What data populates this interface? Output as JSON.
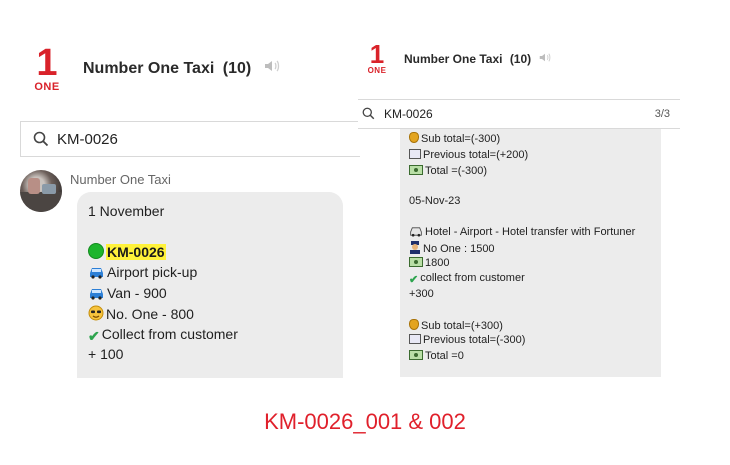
{
  "left_panel": {
    "logo": {
      "number": "1",
      "word": "ONE"
    },
    "chat_title": "Number One Taxi",
    "member_count": "(10)",
    "search_value": "KM-0026",
    "sender_name": "Number One Taxi",
    "message_lines": [
      "1 November",
      "KM-0026",
      "Airport pick-up",
      "Van - 900",
      "No. One - 800",
      "Collect from customer",
      "+ 100"
    ]
  },
  "right_panel": {
    "logo": {
      "number": "1",
      "word": "ONE"
    },
    "chat_title": "Number One Taxi",
    "member_count": "(10)",
    "search_value": "KM-0026",
    "match_counter": "3/3",
    "message_lines": [
      "Sub total=(-300)",
      "Previous total=(+200)",
      "Total =(-300)",
      "05-Nov-23",
      "Hotel - Airport - Hotel transfer with Fortuner",
      "No One : 1500",
      "1800",
      "collect from customer",
      "+300",
      "Sub total=(+300)",
      "Previous total=(-300)",
      "Total =0"
    ]
  },
  "caption": "KM-0026_001 & 002",
  "icons": {
    "search": "search-icon",
    "speaker": "speaker-muted-icon",
    "circle": "green-circle-icon",
    "car": "car-icon",
    "face": "sunglasses-face-icon",
    "check": "check-icon",
    "money": "money-bill-icon",
    "bag": "money-bag-icon",
    "calendar": "calendar-icon",
    "officer": "police-officer-icon"
  },
  "colors": {
    "brand_red": "#d9222a",
    "caption_red": "#e0202b",
    "highlight": "#fff23a",
    "bubble": "#ececec"
  }
}
